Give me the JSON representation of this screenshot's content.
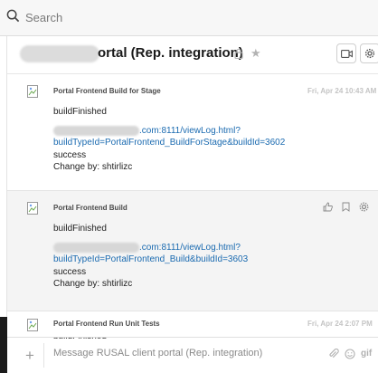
{
  "search": {
    "placeholder": "Search"
  },
  "header": {
    "title": "ortal (Rep. integration)",
    "lock_icon": "lock-icon",
    "star_icon": "star-icon",
    "video_icon": "video-icon",
    "settings_icon": "gear-icon"
  },
  "messages": [
    {
      "sender": "Portal Frontend Build for Stage",
      "time": "Fri, Apr 24 10:43 AM",
      "event": "buildFinished",
      "link_part1": ".com:8111/viewLog.html?",
      "link_part2": "buildTypeId=PortalFrontend_BuildForStage&buildId=3602",
      "status": "success",
      "change": "Change by: shtirlizc"
    },
    {
      "sender": "Portal Frontend Build",
      "time": "",
      "event": "buildFinished",
      "link_part1": ".com:8111/viewLog.html?",
      "link_part2": "buildTypeId=PortalFrontend_Build&buildId=3603",
      "status": "success",
      "change": "Change by: shtirlizc",
      "actions": [
        "thumbs-up-icon",
        "bookmark-icon",
        "more-icon"
      ]
    },
    {
      "sender": "Portal Frontend Run Unit Tests",
      "time": "Fri, Apr 24 2:07 PM",
      "event": "buildFinished"
    }
  ],
  "composer": {
    "placeholder": "Message RUSAL client portal (Rep. integration)",
    "add_label": "+",
    "gif_label": "gif"
  },
  "colors": {
    "link": "#1a6ab0",
    "accent": "#4a4a4a"
  }
}
